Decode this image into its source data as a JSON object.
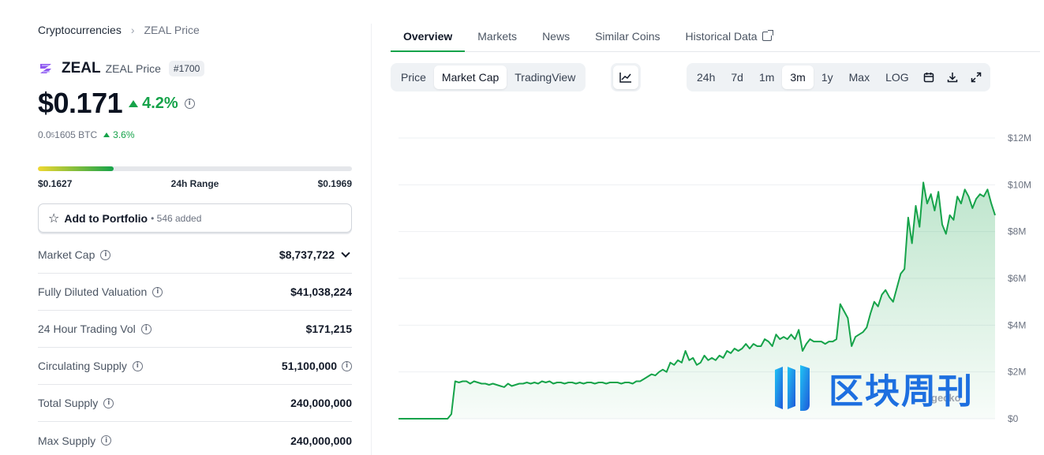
{
  "breadcrumb": {
    "parent": "Cryptocurrencies",
    "current": "ZEAL Price"
  },
  "coin": {
    "symbol": "ZEAL",
    "name": "ZEAL Price",
    "rank": "#1700"
  },
  "price": {
    "value": "$0.171",
    "change": "4.2%"
  },
  "btc": {
    "prefix": "0.0",
    "sub": "5",
    "suffix": "1605 BTC",
    "change": "3.6%"
  },
  "range": {
    "low": "$0.1627",
    "label": "24h Range",
    "high": "$0.1969",
    "fill_fraction": 0.24
  },
  "portfolio": {
    "label": "Add to Portfolio",
    "count": "• 546 added"
  },
  "stats": [
    {
      "label": "Market Cap",
      "value": "$8,737,722"
    },
    {
      "label": "Fully Diluted Valuation",
      "value": "$41,038,224"
    },
    {
      "label": "24 Hour Trading Vol",
      "value": "$171,215"
    },
    {
      "label": "Circulating Supply",
      "value": "51,100,000"
    },
    {
      "label": "Total Supply",
      "value": "240,000,000"
    },
    {
      "label": "Max Supply",
      "value": "240,000,000"
    }
  ],
  "tabs": [
    "Overview",
    "Markets",
    "News",
    "Similar Coins",
    "Historical Data"
  ],
  "chart_types": [
    "Price",
    "Market Cap",
    "TradingView"
  ],
  "periods": [
    "24h",
    "7d",
    "1m",
    "3m",
    "1y",
    "Max",
    "LOG"
  ],
  "watermark": {
    "text": "区块周刊",
    "gecko": "gecko"
  },
  "colors": {
    "accent": "#16a34a",
    "line": "#16a34a",
    "brand_logo": "#7c3aed"
  },
  "chart_data": {
    "type": "area",
    "ylabel": "",
    "ylim": [
      0,
      12
    ],
    "yticks": [
      "$0",
      "$2M",
      "$4M",
      "$6M",
      "$8M",
      "$10M",
      "$12M"
    ],
    "grid": true,
    "values": [
      0,
      0,
      0,
      0,
      0,
      0,
      0,
      0,
      0,
      0,
      0,
      0,
      0,
      0,
      0.2,
      1.6,
      1.55,
      1.6,
      1.6,
      1.5,
      1.6,
      1.55,
      1.5,
      1.5,
      1.45,
      1.5,
      1.45,
      1.4,
      1.35,
      1.5,
      1.4,
      1.45,
      1.5,
      1.5,
      1.55,
      1.5,
      1.55,
      1.5,
      1.6,
      1.55,
      1.6,
      1.5,
      1.55,
      1.55,
      1.5,
      1.55,
      1.55,
      1.5,
      1.55,
      1.5,
      1.55,
      1.55,
      1.5,
      1.55,
      1.55,
      1.5,
      1.55,
      1.55,
      1.55,
      1.5,
      1.55,
      1.55,
      1.5,
      1.6,
      1.6,
      1.7,
      1.8,
      1.9,
      1.85,
      2.0,
      2.1,
      2.0,
      2.4,
      2.3,
      2.5,
      2.4,
      2.9,
      2.5,
      2.6,
      2.3,
      2.4,
      2.7,
      2.5,
      2.6,
      2.5,
      2.7,
      2.6,
      2.9,
      2.8,
      3.0,
      2.9,
      3.0,
      3.2,
      3.0,
      3.2,
      3.1,
      3.1,
      3.4,
      3.3,
      3.1,
      3.6,
      3.4,
      3.5,
      3.4,
      3.6,
      3.4,
      3.8,
      2.9,
      3.2,
      3.4,
      3.3,
      3.3,
      3.3,
      3.2,
      3.3,
      3.3,
      3.4,
      4.9,
      4.6,
      4.3,
      3.1,
      3.5,
      3.6,
      3.7,
      3.9,
      4.5,
      5.0,
      4.8,
      5.3,
      5.5,
      5.2,
      5.0,
      5.6,
      6.2,
      6.4,
      8.6,
      7.5,
      9.1,
      8.2,
      10.1,
      9.2,
      9.6,
      8.9,
      9.7,
      8.3,
      7.9,
      8.7,
      8.5,
      9.5,
      9.2,
      9.8,
      9.5,
      9.0,
      9.4,
      9.6,
      9.5,
      9.8,
      9.2,
      8.7
    ]
  }
}
